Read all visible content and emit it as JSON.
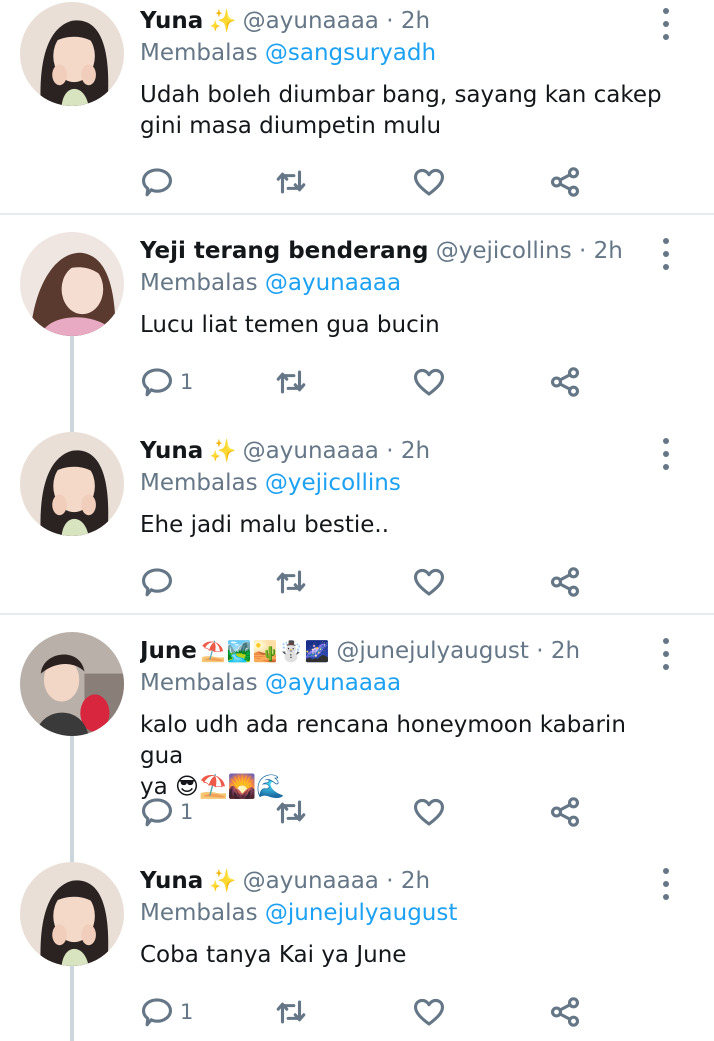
{
  "tweets": [
    {
      "name": "Yuna",
      "badge": "✨",
      "handle": "@ayunaaaa",
      "dot": "·",
      "time": "2h",
      "reply_prefix": "Membalas",
      "reply_to": "@sangsuryadh",
      "text_lines": [
        "Udah boleh diumbar bang, sayang kan cakep",
        "gini masa diumpetin mulu"
      ],
      "reply_count": ""
    },
    {
      "name": "Yeji terang benderang",
      "handle": "@yejicollins",
      "dot": "·",
      "time": "2h",
      "reply_prefix": "Membalas",
      "reply_to": "@ayunaaaa",
      "text_lines": [
        "Lucu liat temen gua bucin"
      ],
      "reply_count": "1"
    },
    {
      "name": "Yuna",
      "badge": "✨",
      "handle": "@ayunaaaa",
      "dot": "·",
      "time": "2h",
      "reply_prefix": "Membalas",
      "reply_to": "@yejicollins",
      "text_lines": [
        "Ehe jadi malu bestie.."
      ],
      "reply_count": ""
    },
    {
      "name": "June",
      "name_emojis": "⛱️🏞️🏜️☃️🌌",
      "handle": "@junejulyaugust",
      "dot": "·",
      "time": "2h",
      "reply_prefix": "Membalas",
      "reply_to": "@ayunaaaa",
      "text_lines": [
        "kalo udh ada rencana honeymoon kabarin gua",
        "ya 😎⛱️🌄🌊"
      ],
      "reply_count": "1"
    },
    {
      "name": "Yuna",
      "badge": "✨",
      "handle": "@ayunaaaa",
      "dot": "·",
      "time": "2h",
      "reply_prefix": "Membalas",
      "reply_to": "@junejulyaugust",
      "text_lines": [
        "Coba tanya Kai ya June"
      ],
      "reply_count": "1"
    }
  ],
  "icons": {
    "reply": "reply-icon",
    "retweet": "retweet-icon",
    "like": "like-icon",
    "share": "share-icon",
    "more": "more-vertical-icon"
  },
  "colors": {
    "mention": "#1da1f2",
    "secondary_text": "#657786",
    "thread_line": "#ccd6dd",
    "divider": "#e6ecf0"
  }
}
